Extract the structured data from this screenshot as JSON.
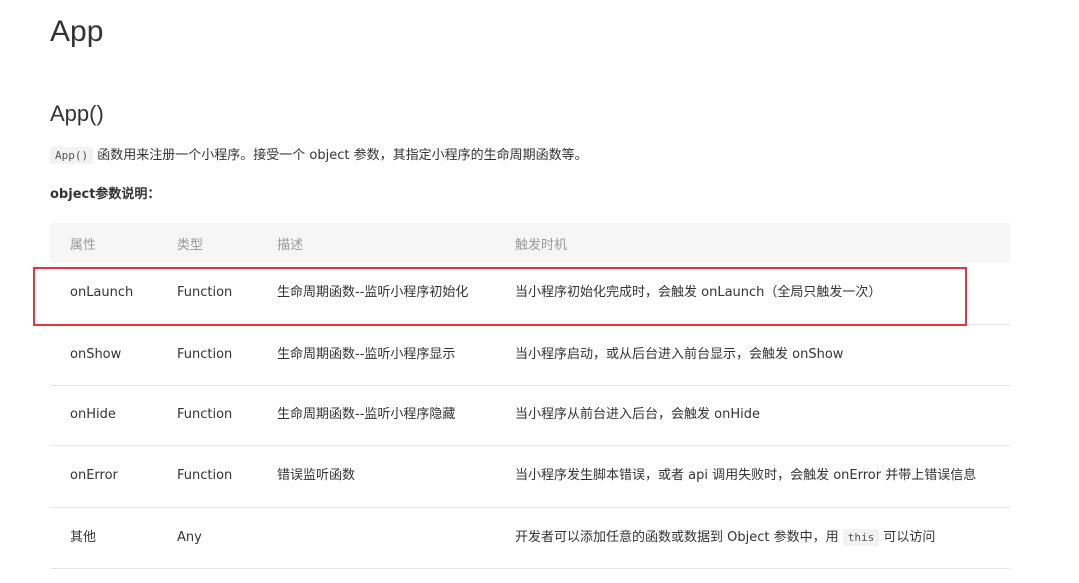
{
  "page": {
    "title": "App",
    "section_title": "App()",
    "description_code": "App()",
    "description_text": " 函数用来注册一个小程序。接受一个 object 参数，其指定小程序的生命周期函数等。",
    "params_title": "object参数说明："
  },
  "table": {
    "headers": [
      "属性",
      "类型",
      "描述",
      "触发时机"
    ],
    "rows": [
      {
        "attr": "onLaunch",
        "type": "Function",
        "desc": "生命周期函数--监听小程序初始化",
        "trigger": "当小程序初始化完成时，会触发 onLaunch（全局只触发一次）"
      },
      {
        "attr": "onShow",
        "type": "Function",
        "desc": "生命周期函数--监听小程序显示",
        "trigger": "当小程序启动，或从后台进入前台显示，会触发 onShow"
      },
      {
        "attr": "onHide",
        "type": "Function",
        "desc": "生命周期函数--监听小程序隐藏",
        "trigger": "当小程序从前台进入后台，会触发 onHide"
      },
      {
        "attr": "onError",
        "type": "Function",
        "desc": "错误监听函数",
        "trigger": "当小程序发生脚本错误，或者 api 调用失败时，会触发 onError 并带上错误信息"
      },
      {
        "attr": "其他",
        "type": "Any",
        "desc": "",
        "trigger_before": "开发者可以添加任意的函数或数据到 Object 参数中，用 ",
        "trigger_code": "this",
        "trigger_after": " 可以访问"
      }
    ]
  },
  "colors": {
    "highlight_border": "#e8343c",
    "header_bg": "#f6f6f6",
    "header_text": "#999999",
    "body_text": "#333333"
  }
}
